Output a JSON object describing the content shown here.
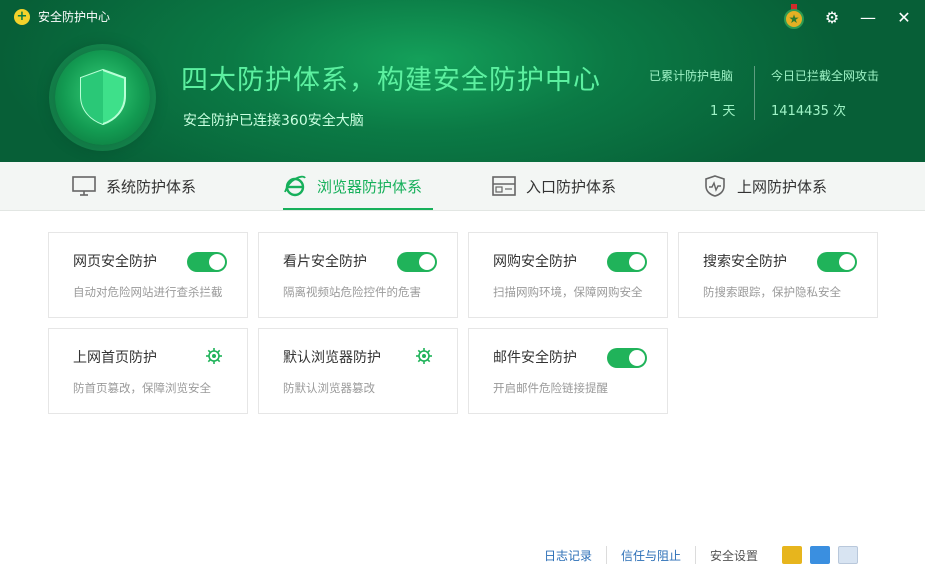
{
  "window": {
    "title": "安全防护中心"
  },
  "banner": {
    "headline": "四大防护体系，构建安全防护中心",
    "subline": "安全防护已连接360安全大脑",
    "stats": {
      "days_label": "已累计防护电脑",
      "days_value": "1 天",
      "blocked_label": "今日已拦截全网攻击",
      "blocked_value": "1414435 次"
    }
  },
  "tabs": [
    {
      "label": "系统防护体系",
      "icon": "monitor-icon",
      "active": false
    },
    {
      "label": "浏览器防护体系",
      "icon": "ie-browser-icon",
      "active": true
    },
    {
      "label": "入口防护体系",
      "icon": "entrance-icon",
      "active": false
    },
    {
      "label": "上网防护体系",
      "icon": "shield-pulse-icon",
      "active": false
    }
  ],
  "cards": [
    {
      "title": "网页安全防护",
      "desc": "自动对危险网站进行查杀拦截",
      "control": "toggle",
      "on": true
    },
    {
      "title": "看片安全防护",
      "desc": "隔离视频站危险控件的危害",
      "control": "toggle",
      "on": true
    },
    {
      "title": "网购安全防护",
      "desc": "扫描网购环境，保障网购安全",
      "control": "toggle",
      "on": true
    },
    {
      "title": "搜索安全防护",
      "desc": "防搜索跟踪，保护隐私安全",
      "control": "toggle",
      "on": true
    },
    {
      "title": "上网首页防护",
      "desc": "防首页篡改，保障浏览安全",
      "control": "gear"
    },
    {
      "title": "默认浏览器防护",
      "desc": "防默认浏览器篡改",
      "control": "gear"
    },
    {
      "title": "邮件安全防护",
      "desc": "开启邮件危险链接提醒",
      "control": "toggle",
      "on": true
    }
  ],
  "footer": {
    "log_link": "日志记录",
    "trust_link": "信任与阻止",
    "setting_text": "安全设置"
  },
  "colors": {
    "accent": "#17b05b",
    "header_dark": "#075f37",
    "toggle_on": "#20b35a"
  }
}
